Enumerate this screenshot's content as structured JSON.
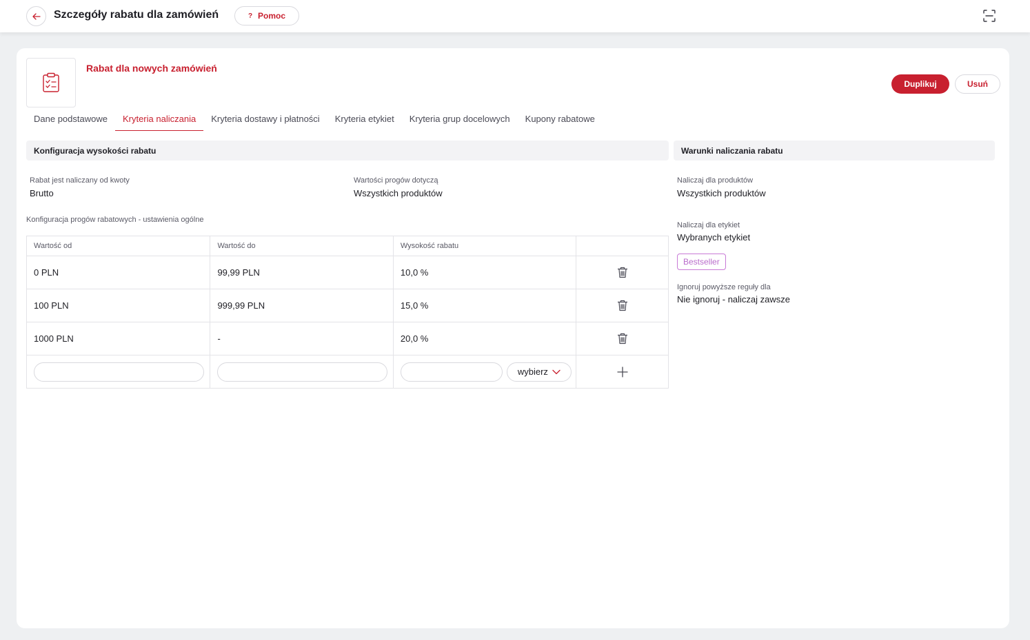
{
  "header": {
    "title": "Szczegóły rabatu dla zamówień",
    "help_label": "Pomoc",
    "help_symbol": "?"
  },
  "discount": {
    "name": "Rabat dla nowych zamówień",
    "duplicate_label": "Duplikuj",
    "delete_label": "Usuń"
  },
  "tabs": [
    {
      "label": "Dane podstawowe",
      "active": false
    },
    {
      "label": "Kryteria naliczania",
      "active": true
    },
    {
      "label": "Kryteria dostawy i płatności",
      "active": false
    },
    {
      "label": "Kryteria etykiet",
      "active": false
    },
    {
      "label": "Kryteria grup docelowych",
      "active": false
    },
    {
      "label": "Kupony rabatowe",
      "active": false
    }
  ],
  "config": {
    "title": "Konfiguracja wysokości rabatu",
    "amount_basis_label": "Rabat jest naliczany od kwoty",
    "amount_basis_value": "Brutto",
    "thresholds_apply_label": "Wartości progów dotyczą",
    "thresholds_apply_value": "Wszystkich produktów",
    "thresholds_section_label": "Konfiguracja progów rabatowych - ustawienia ogólne",
    "table": {
      "headers": [
        "Wartość od",
        "Wartość do",
        "Wysokość rabatu",
        ""
      ],
      "rows": [
        {
          "from": "0 PLN",
          "to": "99,99 PLN",
          "discount": "10,0 %"
        },
        {
          "from": "100 PLN",
          "to": "999,99 PLN",
          "discount": "15,0 %"
        },
        {
          "from": "1000 PLN",
          "to": "-",
          "discount": "20,0 %"
        }
      ],
      "new_row": {
        "from_value": "",
        "to_value": "",
        "discount_value": "",
        "unit_select": "wybierz"
      }
    }
  },
  "conditions": {
    "title": "Warunki naliczania rabatu",
    "products_label": "Naliczaj dla produktów",
    "products_value": "Wszystkich produktów",
    "labels_label": "Naliczaj dla etykiet",
    "labels_value": "Wybranych etykiet",
    "label_badges": [
      "Bestseller"
    ],
    "ignore_label": "Ignoruj powyższe reguły dla",
    "ignore_value": "Nie ignoruj - naliczaj zawsze"
  },
  "colors": {
    "accent": "#c8202f",
    "badge": "#b96ccb",
    "background": "#eef0f2"
  },
  "icons": [
    "arrow-left-icon",
    "question-icon",
    "scan-icon",
    "clipboard-check-icon",
    "trash-icon",
    "chevron-down-icon",
    "plus-icon"
  ]
}
